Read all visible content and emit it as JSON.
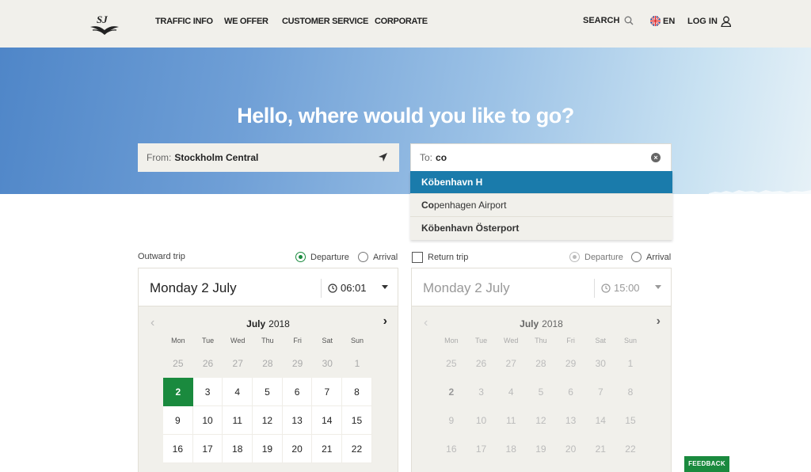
{
  "header": {
    "logo_text": "SJ",
    "nav": [
      "TRAFFIC INFO",
      "WE OFFER",
      "CUSTOMER SERVICE",
      "CORPORATE"
    ],
    "search_label": "SEARCH",
    "lang_label": "EN",
    "login_label": "LOG IN"
  },
  "hero": {
    "title": "Hello, where would you like to go?",
    "from_label": "From:",
    "from_value": "Stockholm Central",
    "to_label": "To:",
    "to_value": "co"
  },
  "suggestions": {
    "item1": "Köbenhavn H",
    "item2_match": "Co",
    "item2_rest": "penhagen Airport",
    "item3": "Köbenhavn Österport"
  },
  "outward": {
    "label": "Outward trip",
    "departure_label": "Departure",
    "arrival_label": "Arrival",
    "date": "Monday 2 July",
    "time": "06:01"
  },
  "return": {
    "label": "Return trip",
    "departure_label": "Departure",
    "arrival_label": "Arrival",
    "date": "Monday 2 July",
    "time": "15:00"
  },
  "calendar": {
    "month": "July",
    "year": "2018",
    "weekdays": [
      "Mon",
      "Tue",
      "Wed",
      "Thu",
      "Fri",
      "Sat",
      "Sun"
    ],
    "rows": [
      [
        "25",
        "26",
        "27",
        "28",
        "29",
        "30",
        "1"
      ],
      [
        "2",
        "3",
        "4",
        "5",
        "6",
        "7",
        "8"
      ],
      [
        "9",
        "10",
        "11",
        "12",
        "13",
        "14",
        "15"
      ],
      [
        "16",
        "17",
        "18",
        "19",
        "20",
        "21",
        "22"
      ]
    ],
    "selected_day": "2"
  },
  "feedback_label": "FEEDBACK",
  "colors": {
    "accent_green": "#1a8a3e",
    "highlight_blue": "#1a7bab",
    "header_bg": "#f1f0eb"
  }
}
